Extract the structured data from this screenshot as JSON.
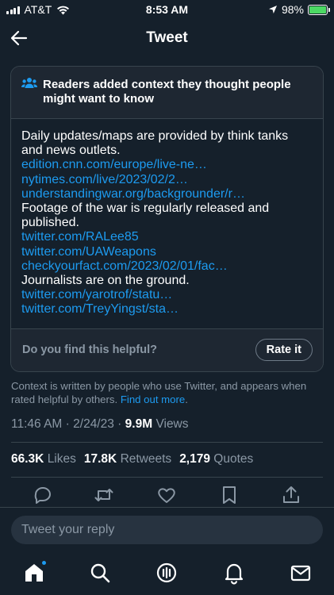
{
  "status_bar": {
    "carrier": "AT&T",
    "time": "8:53 AM",
    "battery_percent": "98%",
    "battery_level": 0.98,
    "icons": [
      "signal-icon",
      "wifi-icon",
      "location-arrow-icon",
      "battery-charging-icon"
    ]
  },
  "header": {
    "title": "Tweet",
    "back_icon": "arrow-left-icon"
  },
  "note": {
    "icon": "people-icon",
    "heading": "Readers added context they thought people might want to know",
    "lines": [
      {
        "text": "Daily updates/maps are provided by think tanks and news outlets.",
        "link": false
      },
      {
        "text": "edition.cnn.com/europe/live-ne…",
        "link": true
      },
      {
        "text": "nytimes.com/live/2023/02/2…",
        "link": true
      },
      {
        "text": "understandingwar.org/backgrounder/r…",
        "link": true
      },
      {
        "text": "Footage of the war is regularly released and published.",
        "link": false
      },
      {
        "text": "twitter.com/RALee85",
        "link": true
      },
      {
        "text": "twitter.com/UAWeapons",
        "link": true
      },
      {
        "text": "checkyourfact.com/2023/02/01/fac…",
        "link": true
      },
      {
        "text": "Journalists are on the ground.",
        "link": false
      },
      {
        "text": "twitter.com/yarotrof/statu…",
        "link": true
      },
      {
        "text": "twitter.com/TreyYingst/sta…",
        "link": true
      }
    ],
    "helpful_question": "Do you find this helpful?",
    "rate_button": "Rate it"
  },
  "context_info": {
    "text": "Context is written by people who use Twitter, and appears when rated helpful by others.",
    "find_out_more": "Find out more",
    "period": "."
  },
  "timestamp": {
    "time": "11:46 AM",
    "separator": "·",
    "date": "2/24/23",
    "views_count": "9.9M",
    "views_label": "Views"
  },
  "stats": {
    "likes_count": "66.3K",
    "likes_label": "Likes",
    "retweets_count": "17.8K",
    "retweets_label": "Retweets",
    "quotes_count": "2,179",
    "quotes_label": "Quotes"
  },
  "actions": [
    "reply-icon",
    "retweet-icon",
    "like-icon",
    "bookmark-icon",
    "share-icon"
  ],
  "reply": {
    "placeholder": "Tweet your reply",
    "value": ""
  },
  "tab_bar": [
    "home-icon",
    "search-icon",
    "spaces-icon",
    "notifications-icon",
    "messages-icon"
  ],
  "colors": {
    "background": "#15202b",
    "link": "#1d9bf0",
    "secondary_text": "#8b98a5",
    "border": "#38444d",
    "battery": "#4cd964"
  }
}
